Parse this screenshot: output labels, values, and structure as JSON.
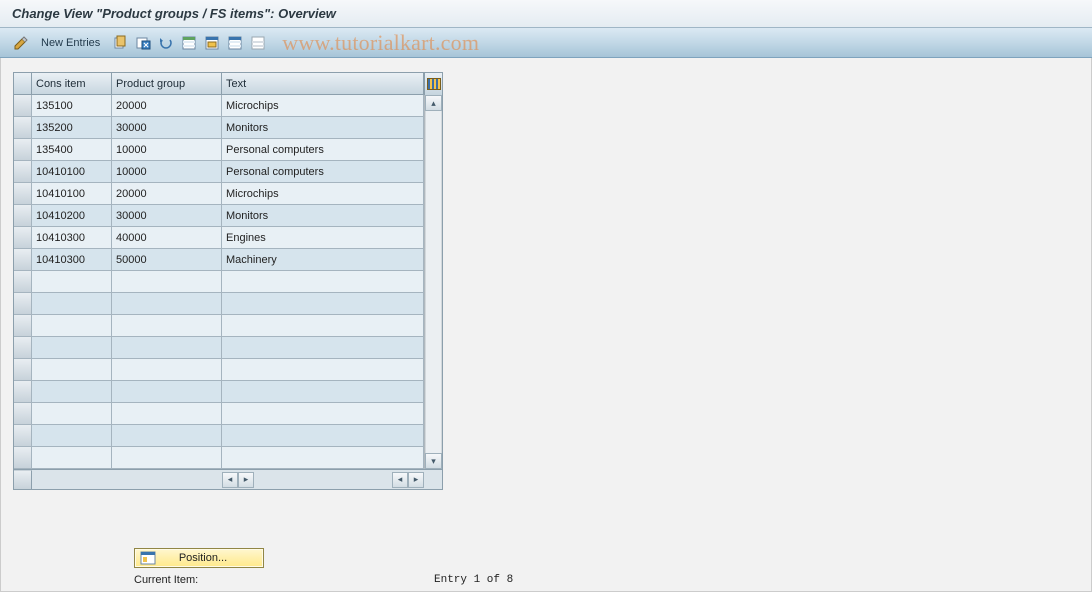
{
  "title": "Change View \"Product groups / FS items\": Overview",
  "toolbar": {
    "new_entries": "New Entries"
  },
  "watermark": "www.tutorialkart.com",
  "table": {
    "headers": {
      "cons_item": "Cons item",
      "product_group": "Product group",
      "text": "Text"
    },
    "rows": [
      {
        "cons_item": "135100",
        "product_group": "20000",
        "text": "Microchips"
      },
      {
        "cons_item": "135200",
        "product_group": "30000",
        "text": "Monitors"
      },
      {
        "cons_item": "135400",
        "product_group": "10000",
        "text": "Personal computers"
      },
      {
        "cons_item": "10410100",
        "product_group": "10000",
        "text": "Personal computers"
      },
      {
        "cons_item": "10410100",
        "product_group": "20000",
        "text": "Microchips"
      },
      {
        "cons_item": "10410200",
        "product_group": "30000",
        "text": "Monitors"
      },
      {
        "cons_item": "10410300",
        "product_group": "40000",
        "text": "Engines"
      },
      {
        "cons_item": "10410300",
        "product_group": "50000",
        "text": "Machinery"
      }
    ],
    "visible_rows": 17
  },
  "position_button": "Position...",
  "status": {
    "label": "Current Item:",
    "entry": "Entry 1 of 8"
  }
}
